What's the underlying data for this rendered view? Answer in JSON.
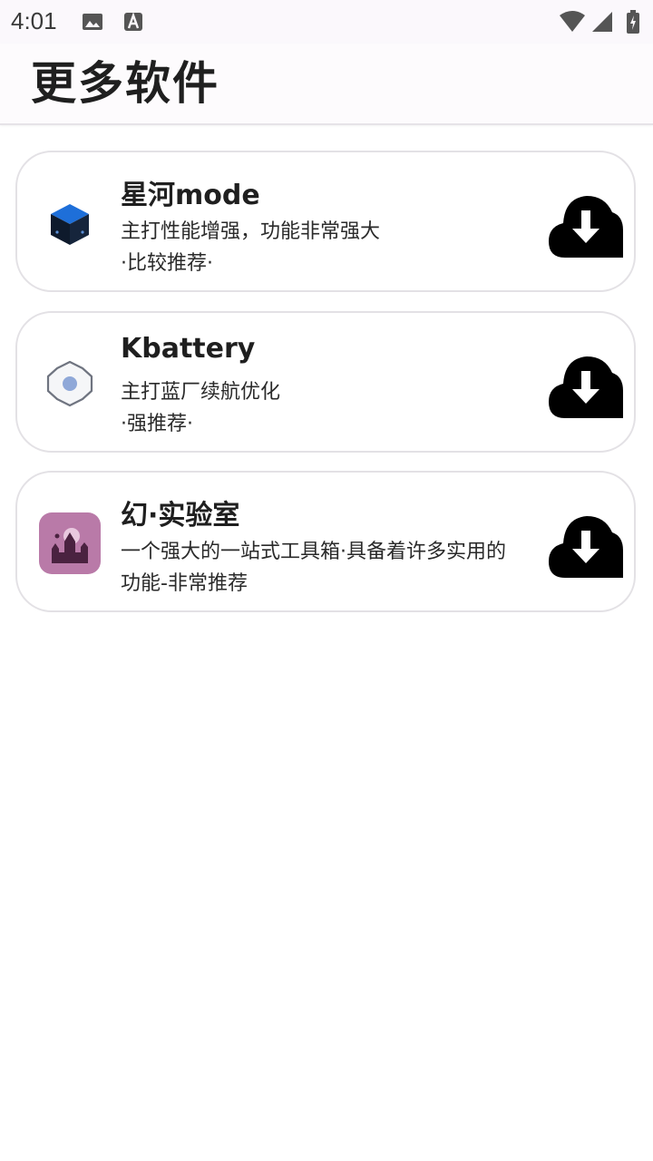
{
  "status_bar": {
    "time": "4:01"
  },
  "header": {
    "title": "更多软件"
  },
  "apps": [
    {
      "name": "星河mode",
      "desc_line1": "主打性能增强，功能非常强大",
      "desc_line2": "·比较推荐·",
      "icon": "blue-cube-icon"
    },
    {
      "name": "Kbattery",
      "desc_line1": "主打蓝厂续航优化",
      "desc_line2": "·强推荐·",
      "icon": "gear-icon"
    },
    {
      "name": "幻·实验室",
      "desc_line1": "一个强大的一站式工具箱·具备着许多实用的",
      "desc_line2": "功能-非常推荐",
      "icon": "castle-icon"
    }
  ],
  "colors": {
    "accent_blue": "#1e6fd9",
    "castle_bg": "#b97aa8",
    "card_border": "#e3e1e5"
  }
}
